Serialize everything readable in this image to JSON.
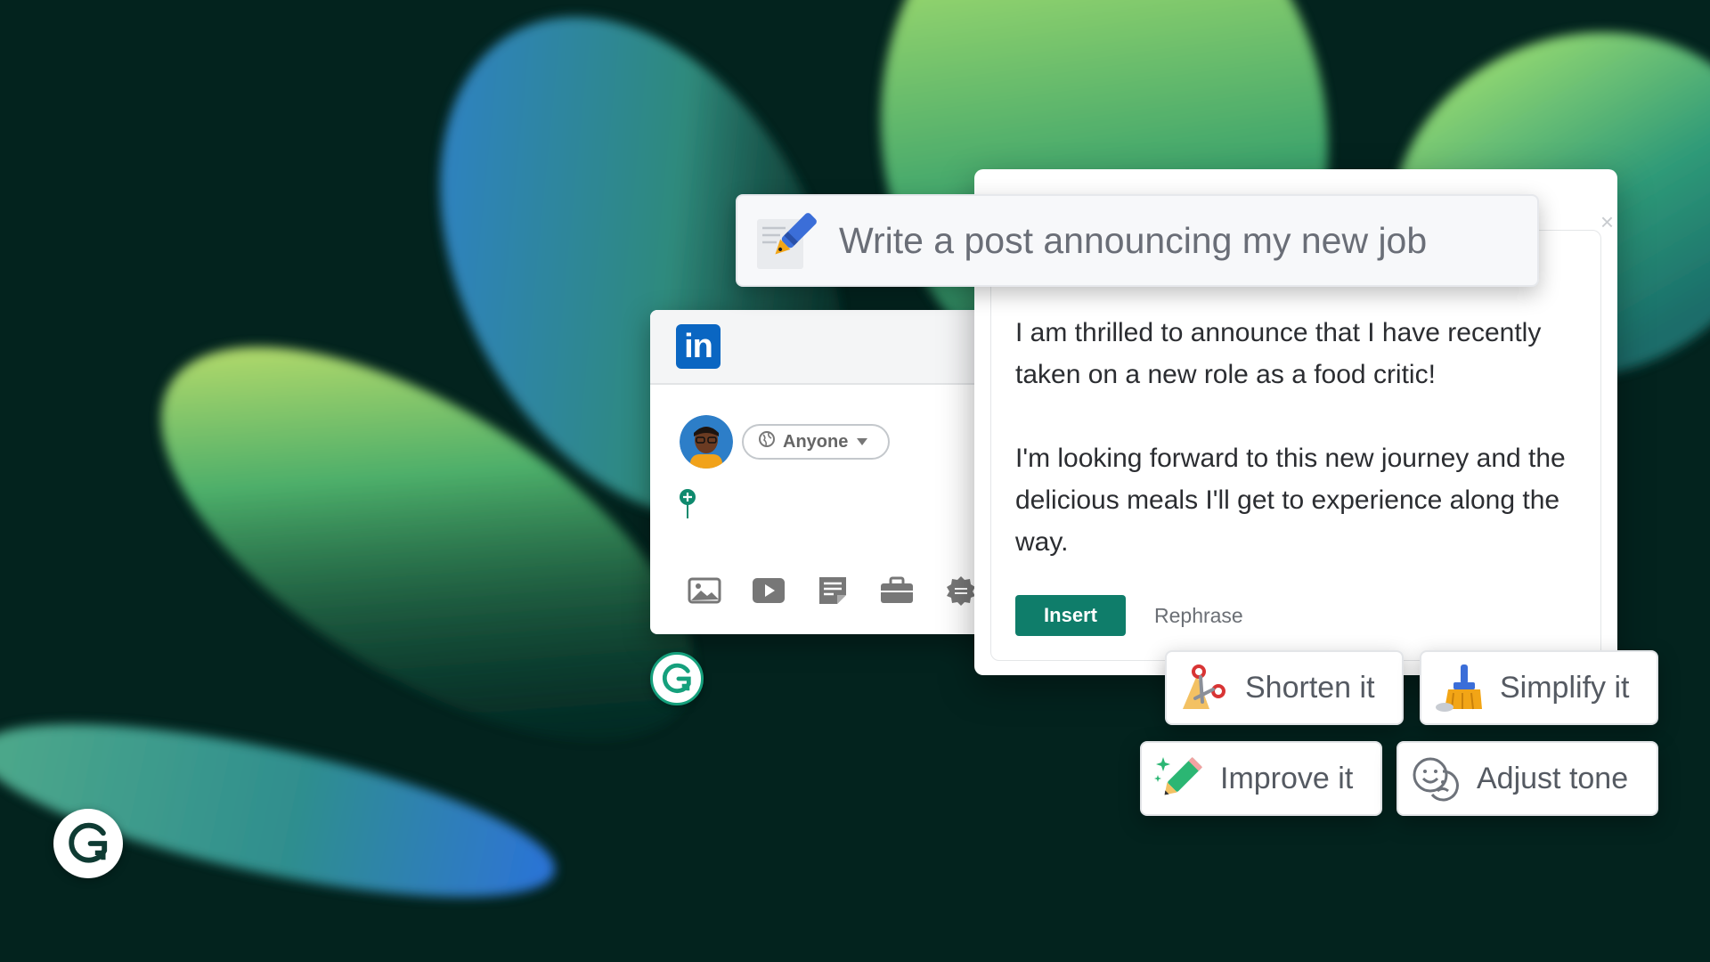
{
  "prompt": {
    "text": "Write a post announcing my new job"
  },
  "linkedin_card": {
    "logo_text": "in",
    "audience_label": "Anyone"
  },
  "result": {
    "paragraphs": [
      "I am thrilled to announce that I have recently taken on a new role as a food critic!",
      "I'm looking forward to this new journey and the delicious meals I'll get to experience along the way."
    ],
    "insert_label": "Insert",
    "rephrase_label": "Rephrase"
  },
  "actions": {
    "shorten": "Shorten it",
    "simplify": "Simplify it",
    "improve": "Improve it",
    "adjust_tone": "Adjust tone"
  },
  "colors": {
    "background": "#03231e",
    "insert_button": "#0f7d6a",
    "linkedin_blue": "#0a66c2",
    "grammarly_green": "#15a07c"
  },
  "icons": {
    "prompt": "pen-writing-icon",
    "shorten": "scissors-icon",
    "simplify": "broom-icon",
    "improve": "sparkle-pencil-icon",
    "adjust_tone": "masks-icon"
  }
}
